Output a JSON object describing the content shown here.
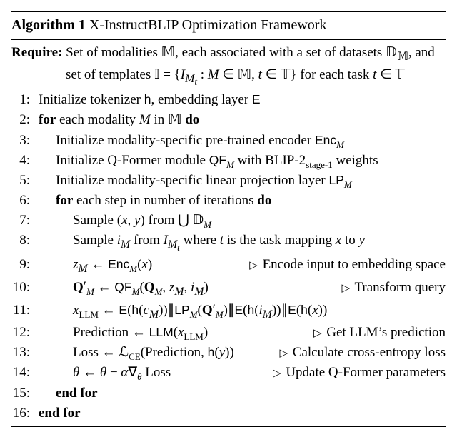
{
  "title_label": "Algorithm 1",
  "title_name": "X-InstructBLIP Optimization Framework",
  "require_label": "Require:",
  "require_text_html": "Set of modalities 𝕄, each associated with a set of datasets 𝔻<sub class='serif-sub'>𝕄</sub>, and set of templates 𝕀 = {<span class='it'>I<sub>M<sub>t</sub></sub></span> : <span class='it'>M</span> ∈ 𝕄, <span class='it'>t</span> ∈ 𝕋} for each task <span class='it'>t</span> ∈ 𝕋",
  "lines": [
    {
      "n": "1:",
      "indent": 0,
      "html": "Initialize tokenizer <span class='sf'>h</span>, embedding layer <span class='sf'>E</span>"
    },
    {
      "n": "2:",
      "indent": 0,
      "html": "<b>for</b> each modality <span class='it'>M</span> in 𝕄 <b>do</b>"
    },
    {
      "n": "3:",
      "indent": 1,
      "html": "Initialize modality-specific pre-trained encoder <span class='sf'>Enc</span><span class='it sub'>M</span>"
    },
    {
      "n": "4:",
      "indent": 1,
      "html": "Initialize Q-Former module <span class='sf'>QF</span><span class='it sub'>M</span> with BLIP-2<span class='sub'>stage-1</span> weights"
    },
    {
      "n": "5:",
      "indent": 1,
      "html": "Initialize modality-specific linear projection layer <span class='sf'>LP</span><span class='it sub'>M</span>"
    },
    {
      "n": "6:",
      "indent": 1,
      "html": "<b>for</b> each step in number of iterations <b>do</b>"
    },
    {
      "n": "7:",
      "indent": 2,
      "html": "Sample (<span class='it'>x</span>, <span class='it'>y</span>) from ⋃ 𝔻<span class='it sub'>M</span>"
    },
    {
      "n": "8:",
      "indent": 2,
      "html": "Sample <span class='it'>i<sub>M</sub></span> from <span class='it'>I<sub>M<sub>t</sub></sub></span> where <span class='it'>t</span> is the task mapping <span class='it'>x</span> to <span class='it'>y</span>"
    },
    {
      "n": "9:",
      "indent": 2,
      "row": true,
      "left_html": "<span class='it'>z<sub>M</sub></span> ← <span class='sf'>Enc</span><span class='it sub'>M</span>(<span class='it'>x</span>)",
      "right_html": "<span class='tri'>▷</span> Encode input to embedding space"
    },
    {
      "n": "10:",
      "indent": 2,
      "row": true,
      "left_html": "<b>Q</b><span class='supprime'>′</span><span class='it sub'>M</span> ← <span class='sf'>QF</span><span class='it sub'>M</span>(<b>Q</b><span class='it sub'>M</span>, <span class='it'>z<sub>M</sub></span>, <span class='it'>i<sub>M</sub></span>)",
      "right_html": "<span class='tri'>▷</span> Transform query"
    },
    {
      "n": "11:",
      "indent": 2,
      "html": "<span class='it'>x</span><span class='sub'>LLM</span> ← <span class='sf'>E</span>(<span class='sf'>h</span>(<span class='it'>c<sub>M</sub></span>))∥<span class='sf'>LP</span><span class='it sub'>M</span>(<b>Q</b><span class='supprime'>′</span><span class='it sub'>M</span>)∥<span class='sf'>E</span>(<span class='sf'>h</span>(<span class='it'>i<sub>M</sub></span>))∥<span class='sf'>E</span>(<span class='sf'>h</span>(<span class='it'>x</span>))"
    },
    {
      "n": "12:",
      "indent": 2,
      "row": true,
      "left_html": "Prediction ← <span class='sf'>LLM</span>(<span class='it'>x</span><span class='sub'>LLM</span>)",
      "right_html": "<span class='tri'>▷</span> Get LLM’s prediction"
    },
    {
      "n": "13:",
      "indent": 2,
      "row": true,
      "left_html": "Loss ← ℒ<span class='sub'>CE</span>(Prediction, <span class='sf'>h</span>(<span class='it'>y</span>))",
      "right_html": "<span class='tri'>▷</span> Calculate cross-entropy loss"
    },
    {
      "n": "14:",
      "indent": 2,
      "row": true,
      "left_html": "<span class='it'>θ</span> ← <span class='it'>θ</span> − <span class='it'>α</span>∇<span class='it sub'>θ</span> Loss",
      "right_html": "<span class='tri'>▷</span> Update Q-Former parameters"
    },
    {
      "n": "15:",
      "indent": 1,
      "html": "<b>end for</b>"
    },
    {
      "n": "16:",
      "indent": 0,
      "html": "<b>end for</b>"
    }
  ],
  "chart_data": {
    "type": "table",
    "title": "Algorithm 1: X-InstructBLIP Optimization Framework",
    "require": "Set of modalities M (blackboard), each associated with a set of datasets D_M, and set of templates I = { I_{M_t} : M ∈ M, t ∈ T } for each task t ∈ T",
    "steps": [
      {
        "n": 1,
        "body": "Initialize tokenizer h, embedding layer E"
      },
      {
        "n": 2,
        "body": "for each modality M in M do"
      },
      {
        "n": 3,
        "body": "Initialize modality-specific pre-trained encoder Enc_M"
      },
      {
        "n": 4,
        "body": "Initialize Q-Former module QF_M with BLIP-2_{stage-1} weights"
      },
      {
        "n": 5,
        "body": "Initialize modality-specific linear projection layer LP_M"
      },
      {
        "n": 6,
        "body": "for each step in number of iterations do"
      },
      {
        "n": 7,
        "body": "Sample (x, y) from ∪ D_M"
      },
      {
        "n": 8,
        "body": "Sample i_M from I_{M_t} where t is the task mapping x to y"
      },
      {
        "n": 9,
        "body": "z_M ← Enc_M(x)",
        "comment": "Encode input to embedding space"
      },
      {
        "n": 10,
        "body": "Q'_M ← QF_M(Q_M, z_M, i_M)",
        "comment": "Transform query"
      },
      {
        "n": 11,
        "body": "x_LLM ← E(h(c_M)) ∥ LP_M(Q'_M) ∥ E(h(i_M)) ∥ E(h(x))"
      },
      {
        "n": 12,
        "body": "Prediction ← LLM(x_LLM)",
        "comment": "Get LLM's prediction"
      },
      {
        "n": 13,
        "body": "Loss ← L_CE(Prediction, h(y))",
        "comment": "Calculate cross-entropy loss"
      },
      {
        "n": 14,
        "body": "θ ← θ − α ∇_θ Loss",
        "comment": "Update Q-Former parameters"
      },
      {
        "n": 15,
        "body": "end for"
      },
      {
        "n": 16,
        "body": "end for"
      }
    ]
  }
}
